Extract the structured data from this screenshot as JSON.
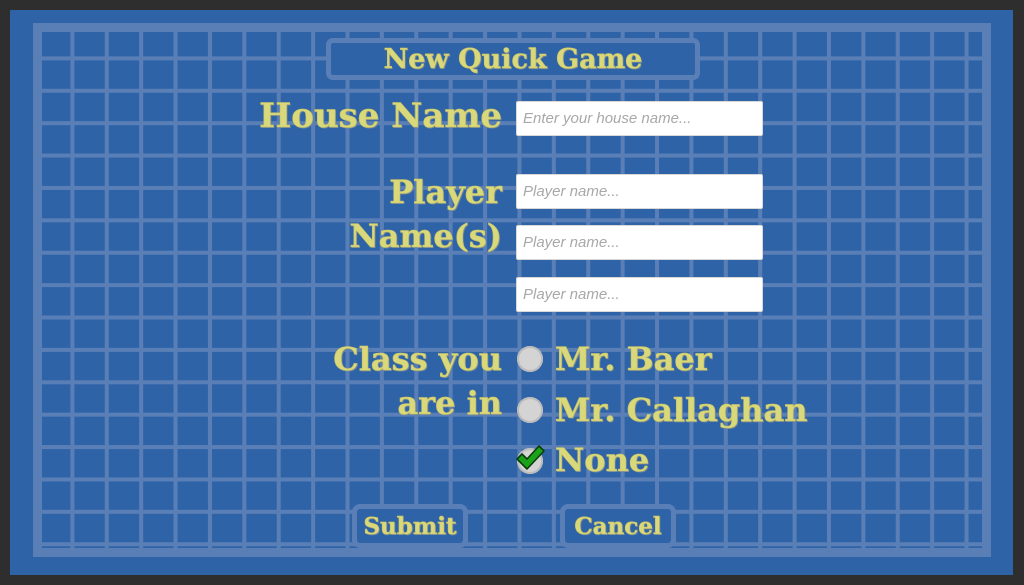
{
  "dialog": {
    "title": "New Quick Game"
  },
  "house": {
    "label": "House Name",
    "placeholder": "Enter your house name...",
    "value": ""
  },
  "players": {
    "label_line1": "Player",
    "label_line2": "Name(s)",
    "inputs": [
      {
        "placeholder": "Player name...",
        "value": ""
      },
      {
        "placeholder": "Player name...",
        "value": ""
      },
      {
        "placeholder": "Player name...",
        "value": ""
      }
    ]
  },
  "class_select": {
    "label_line1": "Class you",
    "label_line2": "are in",
    "options": [
      {
        "label": "Mr. Baer",
        "selected": false
      },
      {
        "label": "Mr. Callaghan",
        "selected": false
      },
      {
        "label": "None",
        "selected": true
      }
    ],
    "check_color": "#1aa31a"
  },
  "buttons": {
    "submit": "Submit",
    "cancel": "Cancel"
  },
  "colors": {
    "background": "#2f63a8",
    "grid_line": "#5a7fb6",
    "chalk_text": "#d9d87a",
    "outer": "#2e2e2e"
  }
}
